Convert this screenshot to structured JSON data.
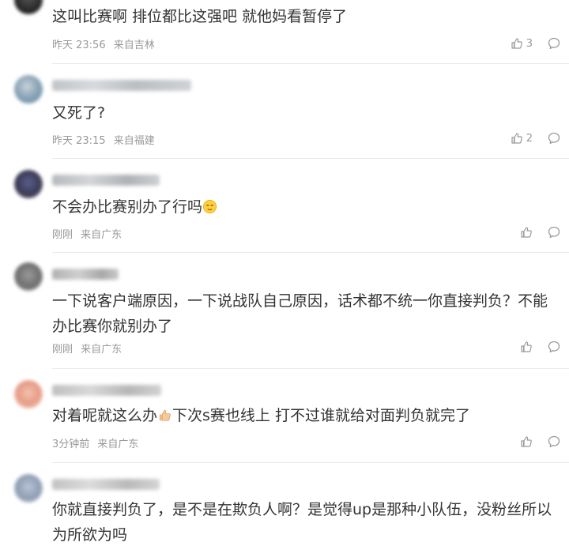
{
  "comments": [
    {
      "text": "这叫比赛啊 排位都比这强吧 就他妈看暂停了",
      "time": "昨天 23:56",
      "location": "来自吉林",
      "likes": "3"
    },
    {
      "text": "又死了?",
      "time": "昨天 23:15",
      "location": "来自福建",
      "likes": "2"
    },
    {
      "text": "不会办比赛别办了行吗",
      "time": "刚刚",
      "location": "来自广东",
      "likes": ""
    },
    {
      "text_line1": "一下说客户端原因，一下说战队自己原因，话术都不统一你直接判负？不能",
      "text_line2": "办比赛你就别办了",
      "time": "刚刚",
      "location": "来自广东",
      "likes": ""
    },
    {
      "text_a": "对着呢就这么办",
      "text_b": "下次s赛也线上 打不过谁就给对面判负就完了",
      "time": "3分钟前",
      "location": "来自广东",
      "likes": ""
    },
    {
      "text_line1": "你就直接判负了，是不是在欺负人啊？是觉得up是那种小队伍，没粉丝所以",
      "text_line2": "为所欲为吗"
    }
  ],
  "icons": {
    "like": "thumbs-up-icon",
    "reply": "reply-bubble-icon",
    "emoji_think": "thinking-face-emoji",
    "emoji_thumb": "thumbs-up-emoji"
  },
  "colors": {
    "text": "#333333",
    "meta": "#999999",
    "divider": "#e9e9e9"
  }
}
